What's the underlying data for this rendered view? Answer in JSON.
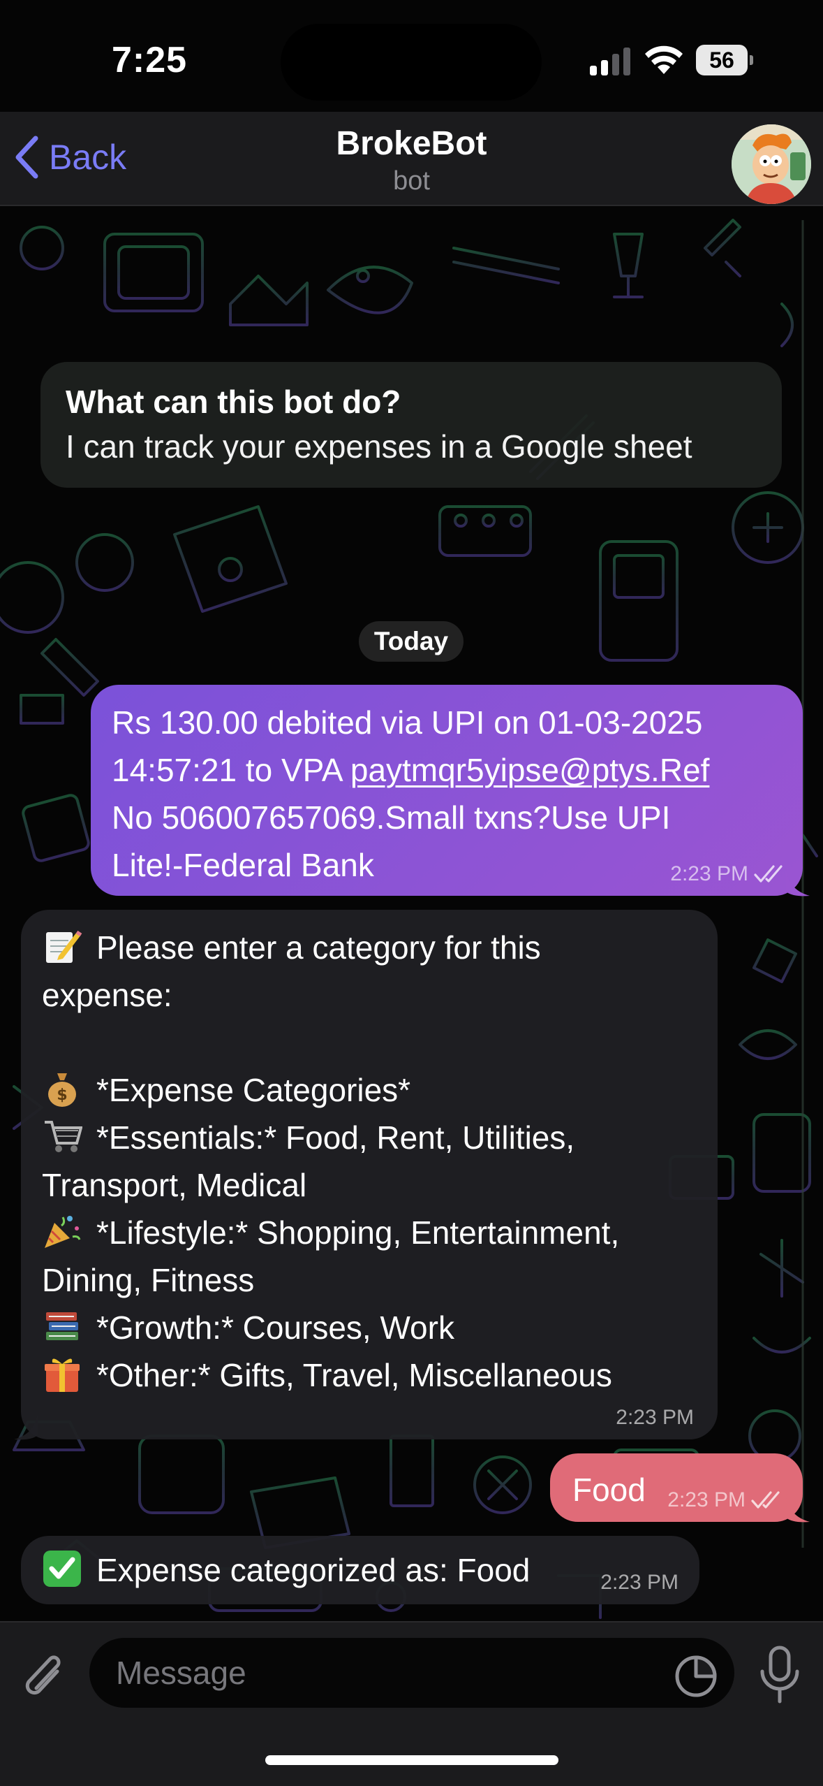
{
  "status_bar": {
    "time": "7:25",
    "battery": "56"
  },
  "header": {
    "back_label": "Back",
    "title": "BrokeBot",
    "subtitle": "bot"
  },
  "bot_info": {
    "title": "What can this bot do?",
    "description": "I can track your expenses in a Google sheet"
  },
  "date_separator": "Today",
  "messages": [
    {
      "direction": "outgoing",
      "text_prefix": "Rs 130.00 debited via UPI on 01-03-2025\n14:57:21 to VPA ",
      "link": "paytmqr5yipse@ptys.Ref",
      "text_suffix": "\nNo 506007657069.Small txns?Use UPI\nLite!-Federal Bank",
      "time": "2:23 PM",
      "read": true
    },
    {
      "direction": "incoming",
      "intro": "Please enter a category for this\nexpense:",
      "heading": "*Expense Categories*",
      "essentials": "*Essentials:* Food, Rent, Utilities,\nTransport, Medical",
      "lifestyle": "*Lifestyle:* Shopping, Entertainment,\nDining, Fitness",
      "growth": "*Growth:* Courses, Work",
      "other": "*Other:* Gifts, Travel, Miscellaneous",
      "time": "2:23 PM"
    },
    {
      "direction": "outgoing",
      "text": "Food",
      "time": "2:23 PM",
      "read": true
    },
    {
      "direction": "incoming",
      "text": "Expense categorized as: Food",
      "time": "2:23 PM"
    }
  ],
  "composer": {
    "placeholder": "Message"
  },
  "colors": {
    "accent": "#7a7cf6",
    "outgoing_bubble": "#8a54d6",
    "food_bubble": "#e06b78",
    "incoming_bubble": "#202024"
  },
  "icons": [
    "chevron-left-icon",
    "signal-icon",
    "wifi-icon",
    "battery-icon",
    "paperclip-icon",
    "sticker-icon",
    "microphone-icon",
    "double-check-icon"
  ]
}
